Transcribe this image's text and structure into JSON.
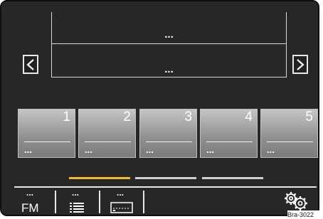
{
  "display": {
    "line_1": "...",
    "line_2": "..."
  },
  "presets": [
    {
      "number": "1",
      "name": "..."
    },
    {
      "number": "2",
      "name": "..."
    },
    {
      "number": "3",
      "name": "..."
    },
    {
      "number": "4",
      "name": "..."
    },
    {
      "number": "5",
      "name": "..."
    }
  ],
  "pagination": {
    "pages": 3,
    "active_page": 1,
    "active_color": "#f3bd1c",
    "inactive_color": "#d0d0d0"
  },
  "bottom_bar": {
    "tabs": [
      {
        "dots": "...",
        "label": "FM",
        "icon": "band-label"
      },
      {
        "dots": "...",
        "label": "",
        "icon": "list-icon"
      },
      {
        "dots": "...",
        "label": "",
        "icon": "preset-bar-icon"
      }
    ],
    "settings_icon": "gears-icon"
  },
  "figure_label": "Bra-3022"
}
